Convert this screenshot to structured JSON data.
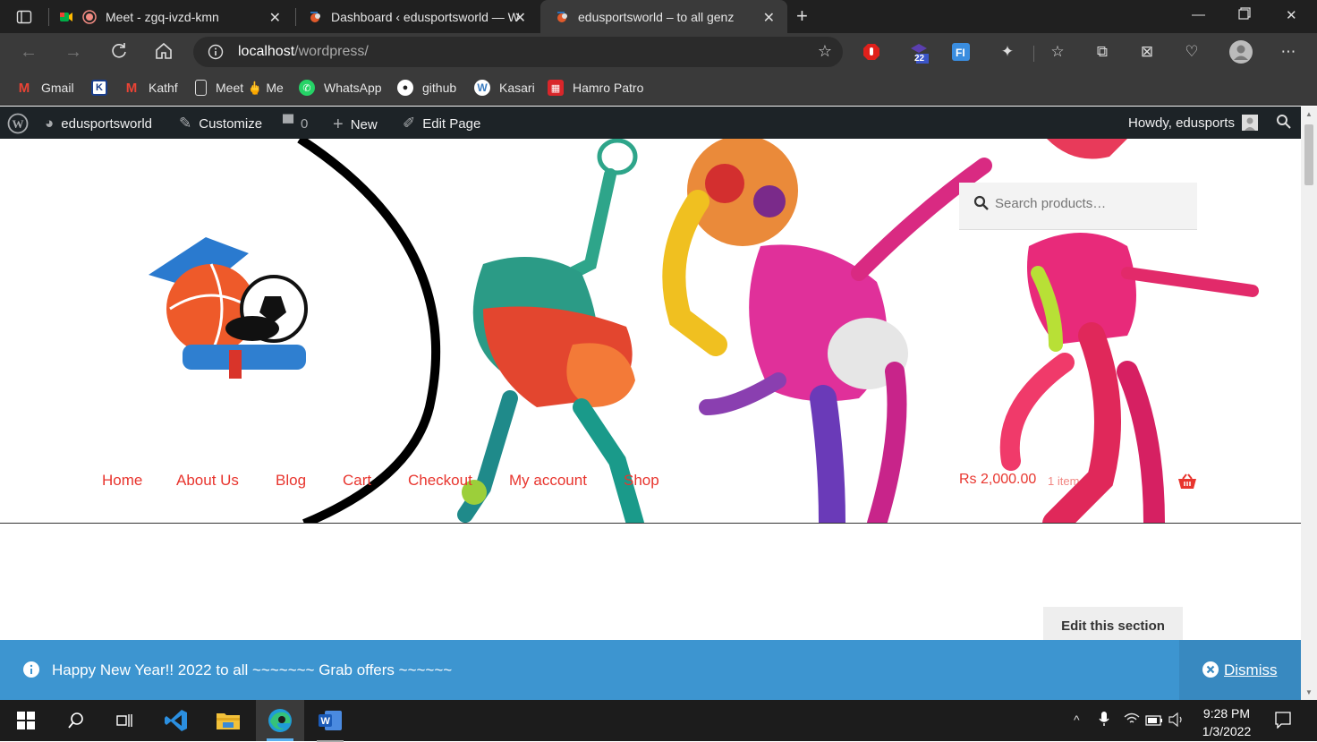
{
  "browser": {
    "tabs": [
      {
        "title": "Meet - zgq-ivzd-kmn",
        "active": false
      },
      {
        "title": "Dashboard ‹ edusportsworld — W",
        "active": false
      },
      {
        "title": "edusportsworld – to all genz",
        "active": true
      }
    ],
    "address": {
      "host": "localhost",
      "path": "/wordpress/"
    },
    "extension_badge": "22",
    "bookmarks": [
      {
        "label": "Gmail",
        "icon": "gmail-icon"
      },
      {
        "label": "",
        "icon": "k-icon"
      },
      {
        "label": "Kathf",
        "icon": "gmail-icon"
      },
      {
        "label": "Meet 🖕 Me",
        "icon": "page-icon"
      },
      {
        "label": "WhatsApp",
        "icon": "whatsapp-icon"
      },
      {
        "label": "github",
        "icon": "github-icon"
      },
      {
        "label": "Kasari",
        "icon": "wordpress-icon"
      },
      {
        "label": "Hamro Patro",
        "icon": "hamro-patro-icon"
      }
    ]
  },
  "wp_admin_bar": {
    "site_name": "edusportsworld",
    "customize": "Customize",
    "comments_count": "0",
    "new": "New",
    "edit_page": "Edit Page",
    "howdy": "Howdy, edusports"
  },
  "site": {
    "search_placeholder": "Search products…",
    "nav": [
      "Home",
      "About Us",
      "Blog",
      "Cart",
      "Checkout",
      "My account",
      "Shop"
    ],
    "cart_amount": "Rs 2,000.00",
    "cart_items": "1 item",
    "edit_section": "Edit this section",
    "notice": "Happy New Year!! 2022 to all ~~~~~~~ Grab offers ~~~~~~",
    "dismiss": "Dismiss",
    "accent_color": "#e8352e",
    "notice_color": "#3d95d0"
  },
  "taskbar": {
    "time": "9:28 PM",
    "date": "1/3/2022"
  }
}
